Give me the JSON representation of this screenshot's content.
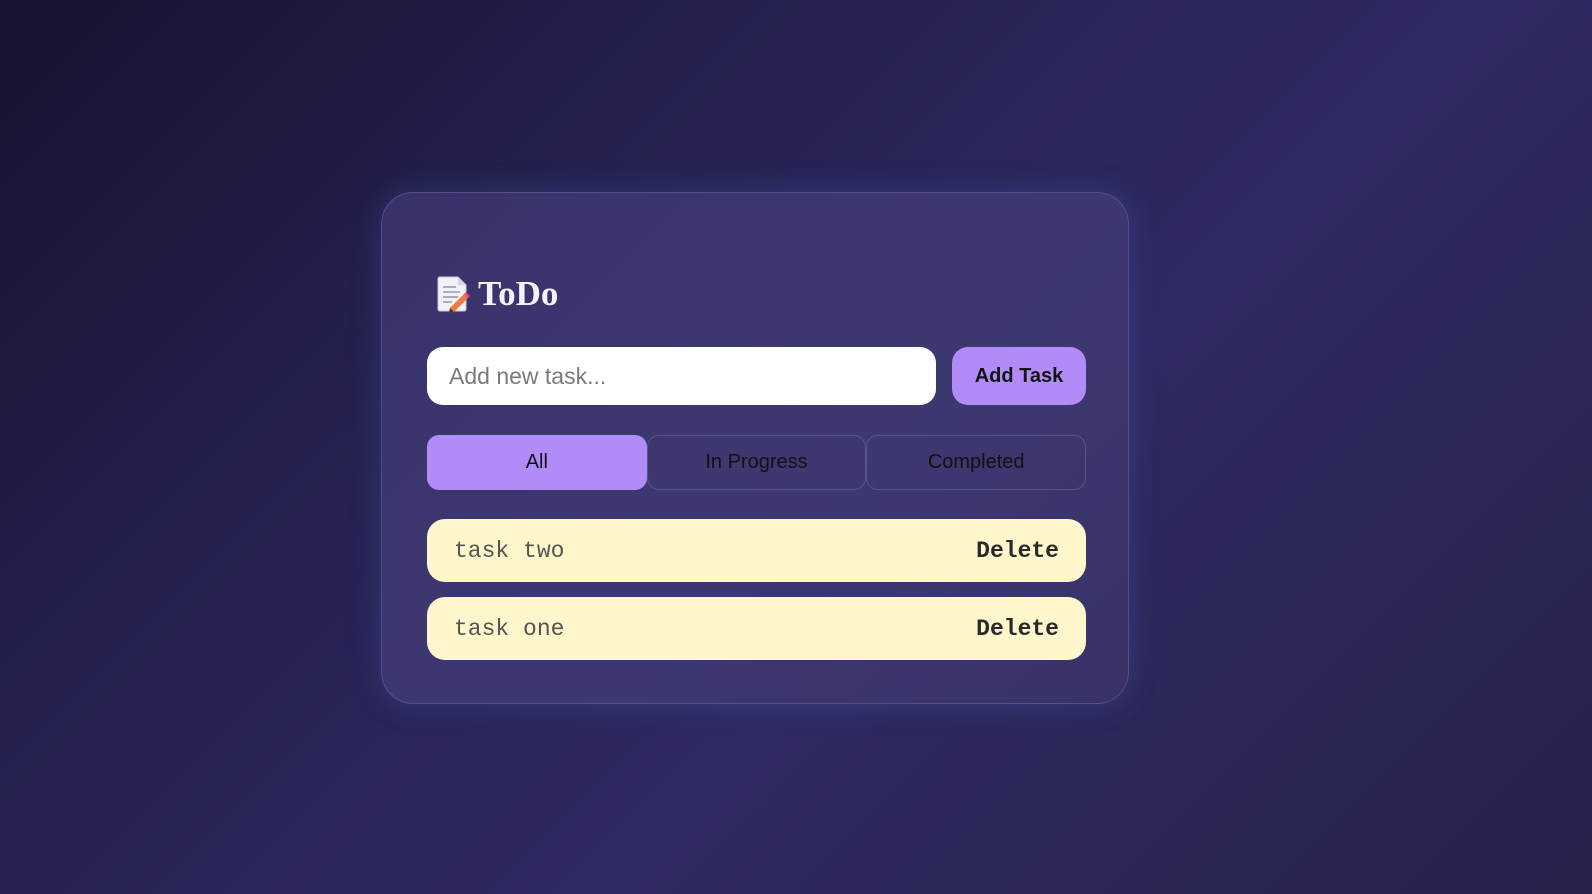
{
  "app": {
    "title": "ToDo",
    "title_icon": "memo-icon"
  },
  "input": {
    "value": "",
    "placeholder": "Add new task..."
  },
  "add_button": {
    "label": "Add Task"
  },
  "filters": [
    {
      "label": "All",
      "active": true
    },
    {
      "label": "In Progress",
      "active": false
    },
    {
      "label": "Completed",
      "active": false
    }
  ],
  "tasks": [
    {
      "text": "task two",
      "delete_label": "Delete"
    },
    {
      "text": "task one",
      "delete_label": "Delete"
    }
  ],
  "colors": {
    "accent": "#b18cf8",
    "task_background": "#fff6cb",
    "input_background": "#ffffff",
    "title": "#f4f2fb"
  }
}
